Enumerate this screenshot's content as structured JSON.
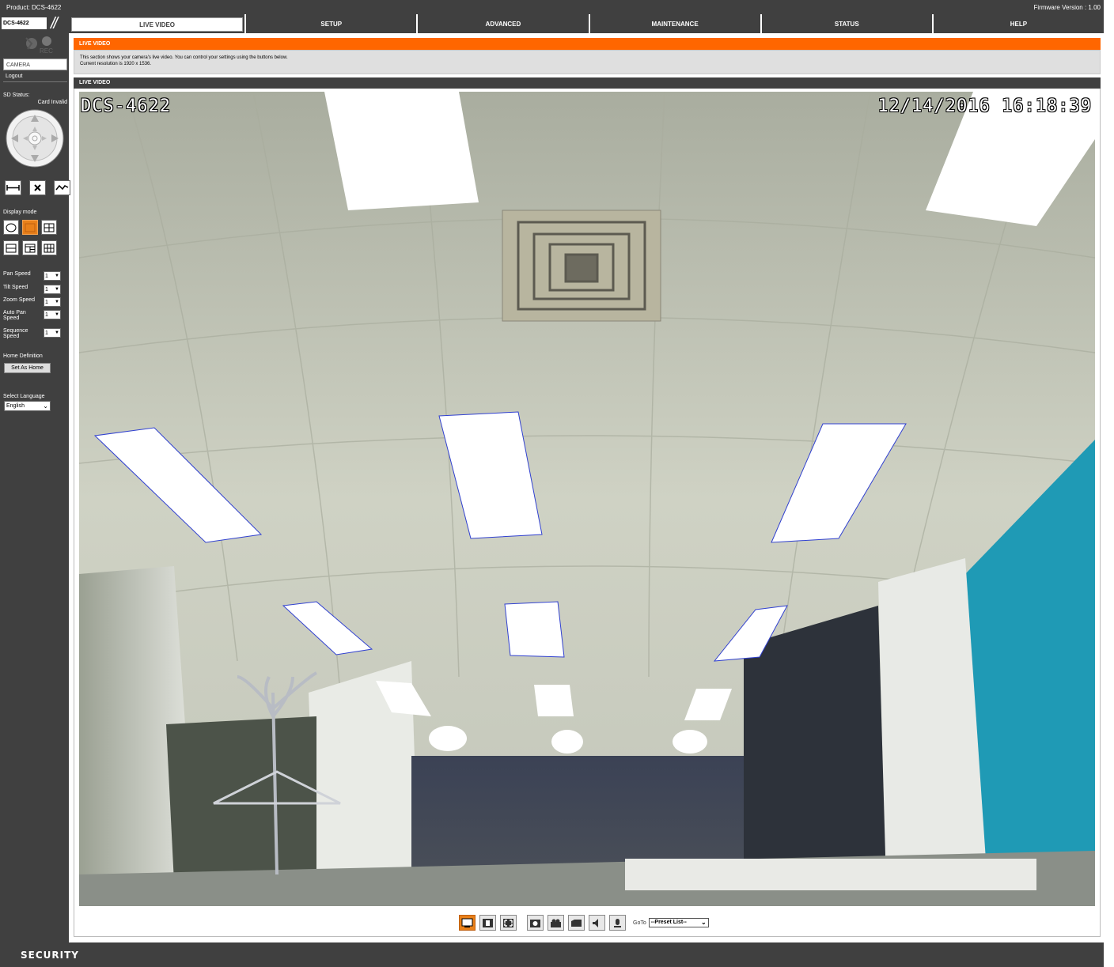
{
  "header": {
    "product": "Product: DCS-4622",
    "firmware": "Firmware Version : 1.00",
    "model_box": "DCS-4622"
  },
  "nav": {
    "tabs": [
      {
        "label": "LIVE VIDEO",
        "active": true
      },
      {
        "label": "SETUP"
      },
      {
        "label": "ADVANCED"
      },
      {
        "label": "MAINTENANCE"
      },
      {
        "label": "STATUS"
      },
      {
        "label": "HELP"
      }
    ]
  },
  "sidebar": {
    "brand_text": "REC",
    "camera_menu": "CAMERA",
    "logout": "Logout",
    "sd_status_label": "SD Status:",
    "sd_status_value": "Card Invalid",
    "display_mode_label": "Display mode",
    "speeds": [
      {
        "label": "Pan Speed",
        "value": "1"
      },
      {
        "label": "Tilt Speed",
        "value": "1"
      },
      {
        "label": "Zoom Speed",
        "value": "1"
      },
      {
        "label": "Auto Pan Speed",
        "value": "1"
      },
      {
        "label": "Sequence Speed",
        "value": "1"
      }
    ],
    "home_label": "Home Definition",
    "home_button": "Set As Home",
    "language_label": "Select Language",
    "language_value": "English"
  },
  "main": {
    "section_title": "LIVE VIDEO",
    "description_line1": "This section shows your camera's live video. You can control your settings using the buttons below.",
    "description_line2": "Current resolution is 1920 x 1536.",
    "video_title": "LIVE VIDEO",
    "osd_camera_name": "DCS-4622",
    "osd_timestamp": "12/14/2016 16:18:39"
  },
  "toolbar": {
    "goto_label": "GoTo",
    "preset_value": "--Preset List--",
    "buttons": [
      "fit-view-icon",
      "full-size-icon",
      "full-screen-icon",
      "snapshot-icon",
      "record-icon",
      "storage-folder-icon",
      "speaker-icon",
      "microphone-icon"
    ]
  },
  "footer": {
    "label": "SECURITY"
  },
  "colors": {
    "chrome_dark": "#404040",
    "accent_orange": "#ff6600",
    "selected_orange": "#e8801a",
    "wall_teal": "#1f9ab5"
  }
}
